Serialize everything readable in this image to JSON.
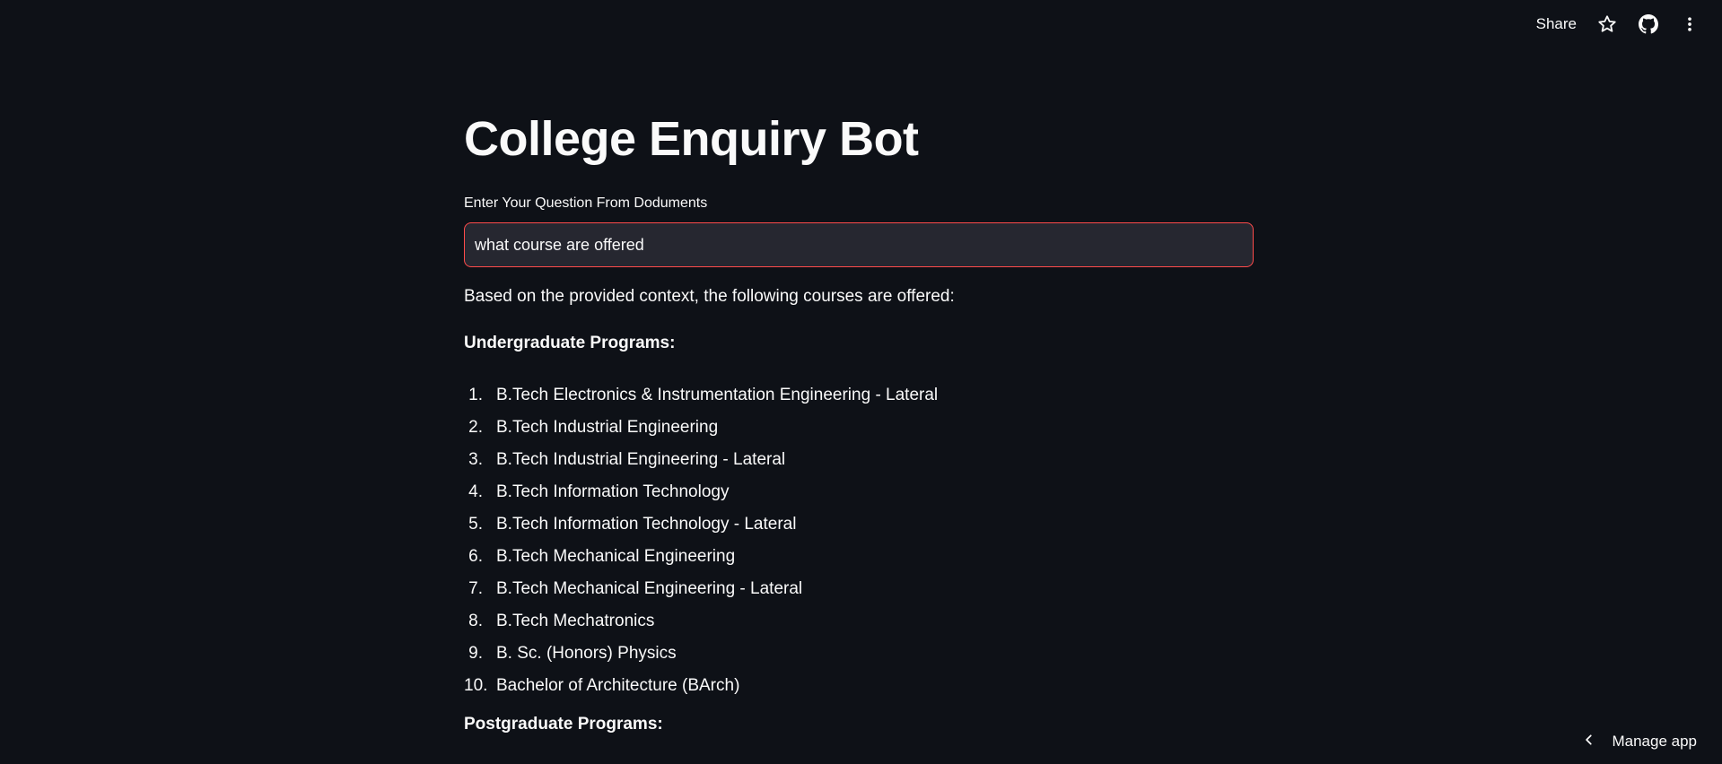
{
  "toolbar": {
    "share_label": "Share",
    "star_icon": "star-icon",
    "github_icon": "github-icon",
    "menu_icon": "more-vert-icon"
  },
  "page": {
    "title": "College Enquiry Bot"
  },
  "question_input": {
    "label": "Enter Your Question From Doduments",
    "value": "what course are offered"
  },
  "answer": {
    "intro": "Based on the provided context, the following courses are offered:",
    "undergraduate_heading": "Undergraduate Programs:",
    "undergraduate_courses": [
      {
        "num": "1.",
        "name": "B.Tech Electronics & Instrumentation Engineering - Lateral"
      },
      {
        "num": "2.",
        "name": "B.Tech Industrial Engineering"
      },
      {
        "num": "3.",
        "name": "B.Tech Industrial Engineering - Lateral"
      },
      {
        "num": "4.",
        "name": "B.Tech Information Technology"
      },
      {
        "num": "5.",
        "name": "B.Tech Information Technology - Lateral"
      },
      {
        "num": "6.",
        "name": "B.Tech Mechanical Engineering"
      },
      {
        "num": "7.",
        "name": "B.Tech Mechanical Engineering - Lateral"
      },
      {
        "num": "8.",
        "name": "B.Tech Mechatronics"
      },
      {
        "num": "9.",
        "name": "B. Sc. (Honors) Physics"
      },
      {
        "num": "10.",
        "name": "Bachelor of Architecture (BArch)"
      }
    ],
    "postgraduate_heading": "Postgraduate Programs:"
  },
  "manage_app": {
    "label": "Manage app"
  },
  "colors": {
    "background": "#0e1117",
    "text": "#fafafa",
    "input_background": "#262730",
    "input_border_focus": "#ff4b4b"
  }
}
